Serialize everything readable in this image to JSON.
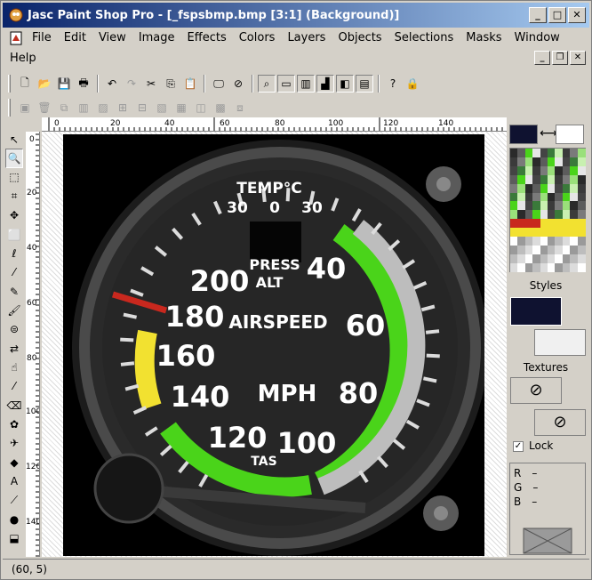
{
  "window": {
    "title": "Jasc Paint Shop Pro - [_fspsbmp.bmp [3:1] (Background)]"
  },
  "menu": {
    "row1": [
      "File",
      "Edit",
      "View",
      "Image",
      "Effects",
      "Colors",
      "Layers",
      "Objects",
      "Selections",
      "Masks",
      "Window"
    ],
    "row2": [
      "Help"
    ]
  },
  "ruler": {
    "h_labels": [
      "0",
      "20",
      "40",
      "60",
      "80",
      "100",
      "120",
      "140"
    ],
    "v_labels": [
      "0",
      "20",
      "40",
      "60",
      "80",
      "100",
      "120",
      "140"
    ]
  },
  "gauge": {
    "temp_title": "TEMP°C",
    "temp_scale": [
      "30",
      "0",
      "30"
    ],
    "press_alt": [
      "PRESS",
      "ALT"
    ],
    "airspeed": "AIRSPEED",
    "unit": "MPH",
    "tas": "TAS",
    "speeds": [
      "200",
      "180",
      "160",
      "140",
      "120",
      "100",
      "80",
      "60",
      "40"
    ]
  },
  "palette": {
    "styles_label": "Styles",
    "textures_label": "Textures",
    "lock_label": "Lock",
    "rgb": [
      {
        "k": "R",
        "v": "–"
      },
      {
        "k": "G",
        "v": "–"
      },
      {
        "k": "B",
        "v": "–"
      }
    ],
    "fg_color": "#0f1230",
    "bg_color": "#ffffff"
  },
  "status": {
    "coords": "(60, 5)"
  },
  "icons": [
    "app-icon",
    "doc-icon",
    "new-icon",
    "open-icon",
    "save-icon",
    "print-icon",
    "undo-icon",
    "redo-icon",
    "cut-icon",
    "copy-icon",
    "paste-icon",
    "zoom-icon",
    "help-icon"
  ]
}
